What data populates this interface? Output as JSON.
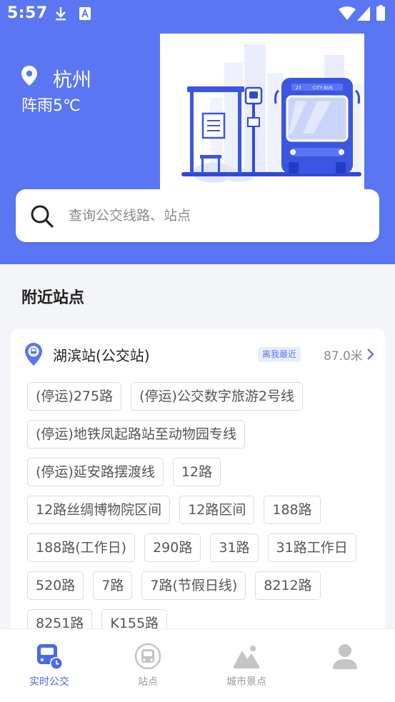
{
  "status_bar": {
    "time": "5:57"
  },
  "location": {
    "city": "杭州",
    "weather": "阵雨5℃",
    "icon": "location-pin-icon"
  },
  "illustration": {
    "bus_sign": "CITY BUS",
    "route_number": "23"
  },
  "search": {
    "placeholder": "查询公交线路、站点",
    "icon": "search-icon"
  },
  "nearby": {
    "title": "附近站点",
    "station": {
      "name": "湖滨站(公交站)",
      "badge": "离我最近",
      "distance": "87.0米",
      "routes": [
        "(停运)275路",
        "(停运)公交数字旅游2号线",
        "(停运)地铁凤起路站至动物园专线",
        "(停运)延安路摆渡线",
        "12路",
        "12路丝绸博物院区间",
        "12路区间",
        "188路",
        "188路(工作日)",
        "290路",
        "31路",
        "31路工作日",
        "520路",
        "7路",
        "7路(节假日线)",
        "8212路",
        "8251路",
        "K155路"
      ]
    }
  },
  "tabs": [
    {
      "label": "实时公交",
      "icon": "bus-clock-icon",
      "active": true
    },
    {
      "label": "站点",
      "icon": "bus-stop-icon",
      "active": false
    },
    {
      "label": "城市景点",
      "icon": "mountain-icon",
      "active": false
    },
    {
      "label": "",
      "icon": "user-icon",
      "active": false
    }
  ],
  "colors": {
    "primary": "#5a76f3",
    "background": "#f4f5f8"
  }
}
